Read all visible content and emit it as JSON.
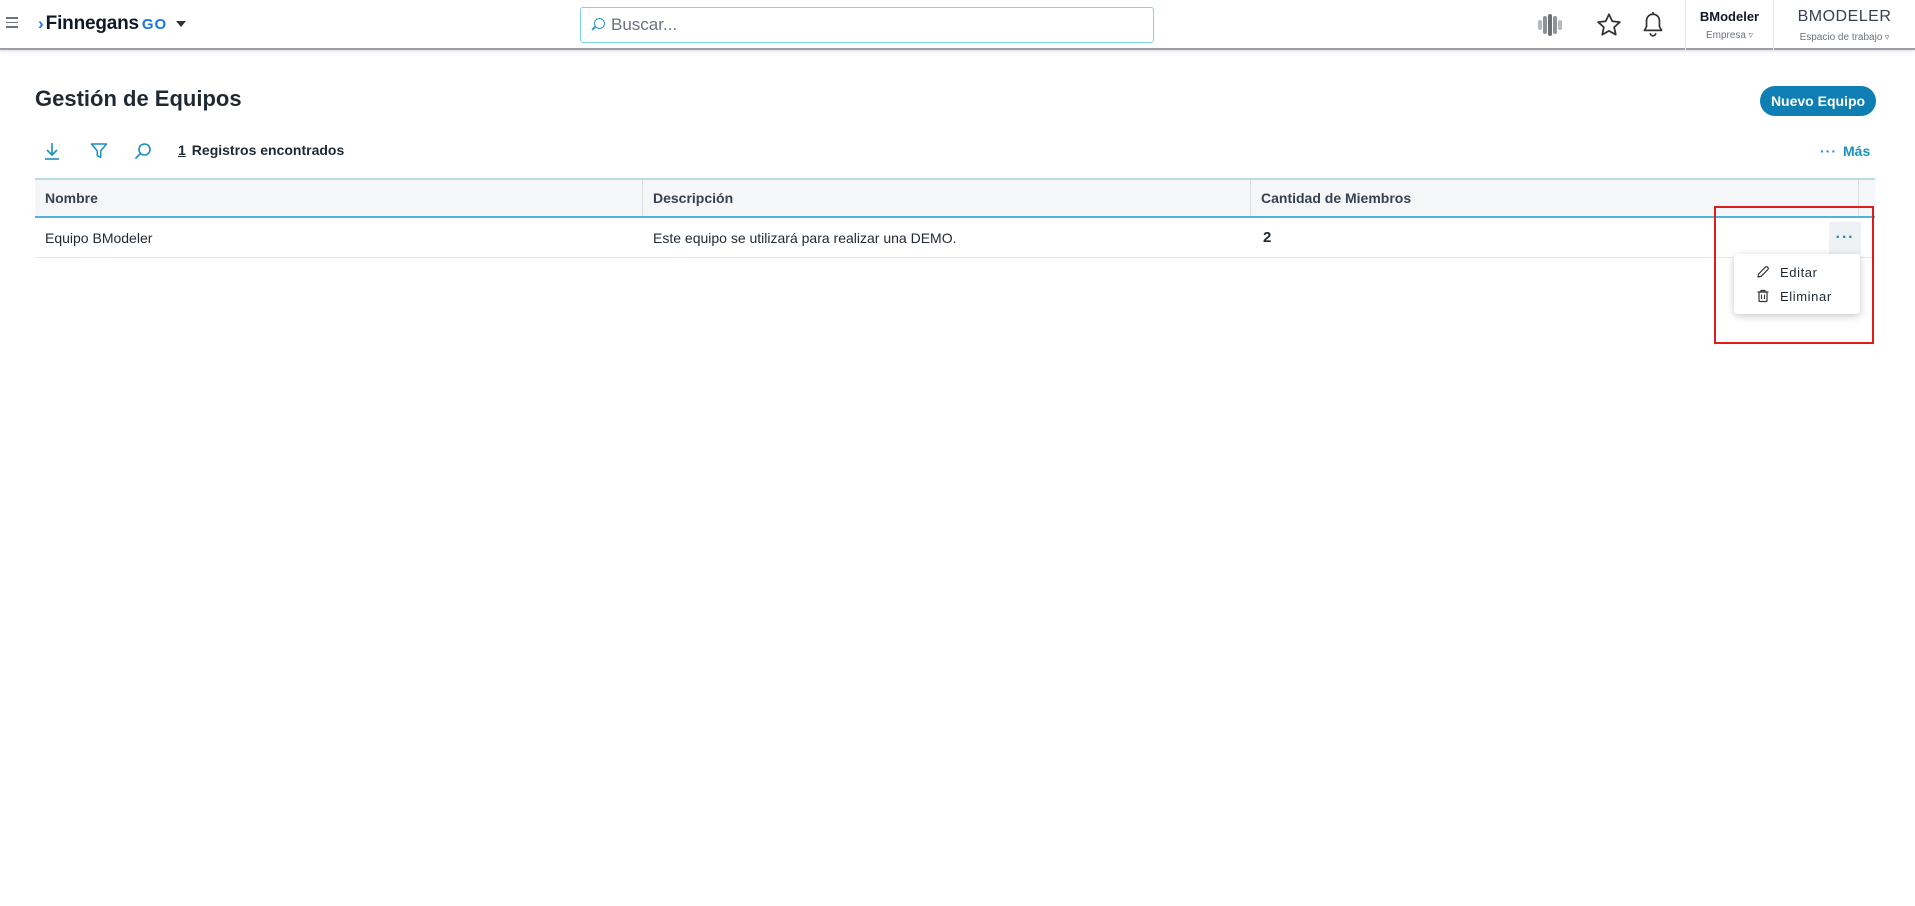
{
  "header": {
    "logo_text": "Finnegans",
    "logo_suffix": "GO",
    "search_placeholder": "Buscar...",
    "company": {
      "name": "BModeler",
      "label": "Empresa"
    },
    "workspace": {
      "name": "BMODELER",
      "label": "Espacio de trabajo"
    }
  },
  "page": {
    "title": "Gestión de Equipos",
    "new_button": "Nuevo Equipo",
    "records_count": "1",
    "records_label": "Registros encontrados",
    "more_dots": "···",
    "more_label": "Más"
  },
  "table": {
    "columns": [
      "Nombre",
      "Descripción",
      "Cantidad de Miembros"
    ],
    "rows": [
      {
        "name": "Equipo BModeler",
        "description": "Este equipo se utilizará para realizar una DEMO.",
        "members": "2"
      }
    ],
    "row_menu_label": "···"
  },
  "row_menu": {
    "items": [
      {
        "label": "Editar",
        "icon": "pencil-icon"
      },
      {
        "label": "Eliminar",
        "icon": "trash-icon"
      }
    ]
  },
  "colors": {
    "accent": "#0f7fb3",
    "link": "#1a8fc0",
    "logo_blue": "#1a73e8",
    "highlight": "#e01b1b"
  }
}
